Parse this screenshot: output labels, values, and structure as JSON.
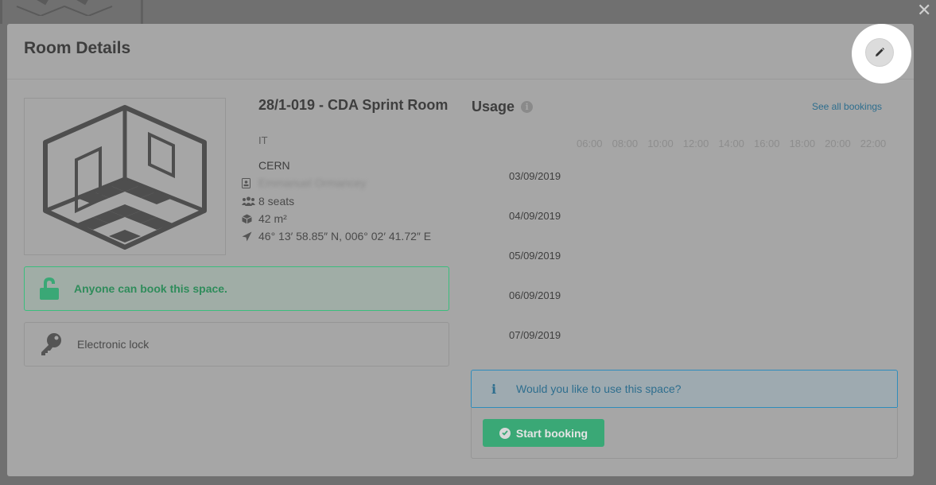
{
  "modal": {
    "title": "Room Details",
    "close_icon": "close-icon",
    "edit_icon": "pencil-icon"
  },
  "room": {
    "title": "28/1-019 - CDA Sprint Room",
    "division": "IT",
    "site": "CERN",
    "owner": "Emmanuel Ormancey",
    "seats": "8 seats",
    "surface": "42 m²",
    "coordinates": "46° 13′ 58.85″ N, 006° 02′ 41.72″ E",
    "public_notice": "Anyone can book this space.",
    "feature": "Electronic lock"
  },
  "usage": {
    "title": "Usage",
    "see_all": "See all bookings",
    "hours": [
      "06:00",
      "08:00",
      "10:00",
      "12:00",
      "14:00",
      "16:00",
      "18:00",
      "20:00",
      "22:00"
    ],
    "dates": [
      "03/09/2019",
      "04/09/2019",
      "05/09/2019",
      "06/09/2019",
      "07/09/2019"
    ]
  },
  "booking": {
    "question": "Would you like to use this space?",
    "start_label": "Start booking"
  },
  "colors": {
    "success": "#3bbd7d",
    "info": "#2e8cbc"
  }
}
